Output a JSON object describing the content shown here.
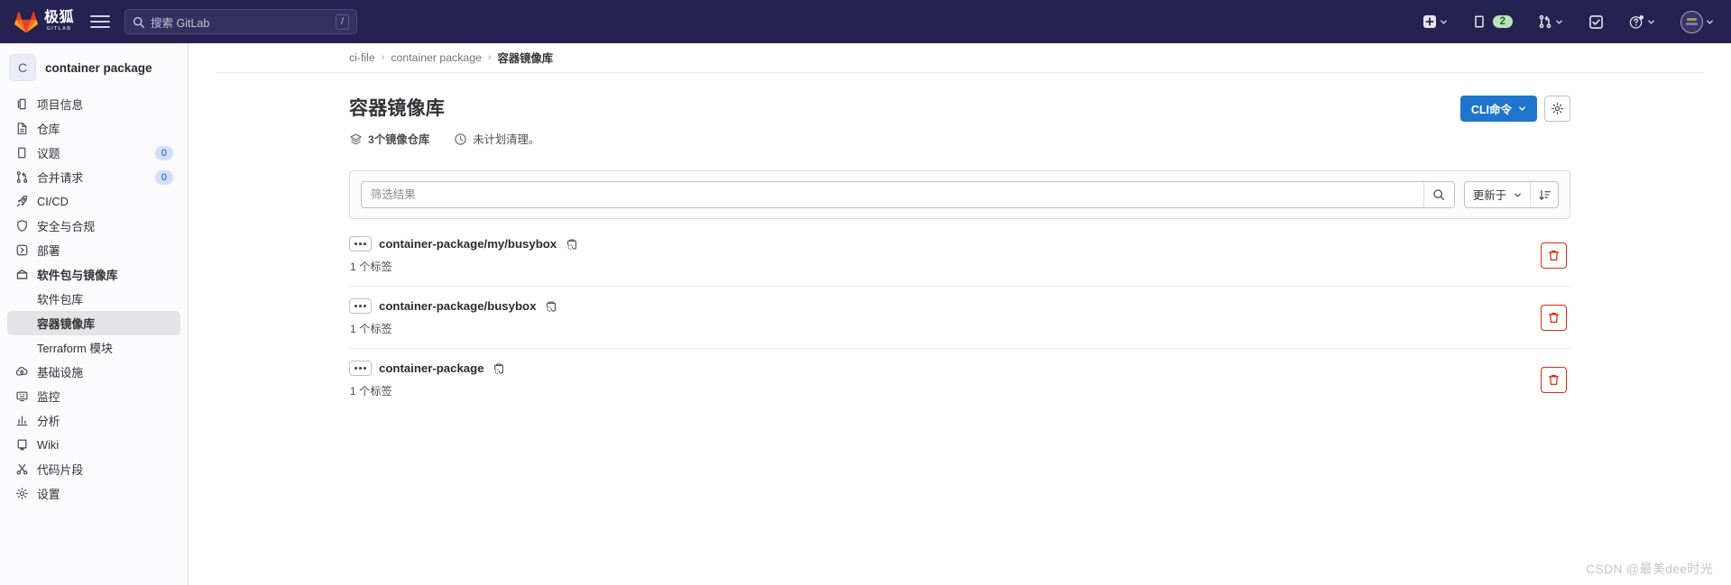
{
  "topbar": {
    "brand_cn": "极狐",
    "brand_sub": "GITLAB",
    "menu_label": "主菜单",
    "search": {
      "placeholder": "搜索 GitLab",
      "shortcut": "/"
    },
    "actions": {
      "create_label": "创建新的…",
      "issues_label": "议题",
      "issues_count": "2",
      "merge_requests_label": "合并请求",
      "todos_label": "待办事项",
      "help_label": "帮助",
      "user_label": "用户菜单"
    }
  },
  "sidebar": {
    "project": {
      "initial": "C",
      "name": "container package"
    },
    "items": [
      {
        "label": "项目信息",
        "icon": "project-information-icon",
        "badge": ""
      },
      {
        "label": "仓库",
        "icon": "repository-icon",
        "badge": ""
      },
      {
        "label": "议题",
        "icon": "issues-icon",
        "badge": "0"
      },
      {
        "label": "合并请求",
        "icon": "merge-request-icon",
        "badge": "0"
      },
      {
        "label": "CI/CD",
        "icon": "rocket-icon",
        "badge": ""
      },
      {
        "label": "安全与合规",
        "icon": "shield-icon",
        "badge": ""
      },
      {
        "label": "部署",
        "icon": "deployments-icon",
        "badge": ""
      },
      {
        "label": "软件包与镜像库",
        "icon": "package-icon",
        "badge": ""
      }
    ],
    "subitems": [
      {
        "label": "软件包库",
        "active": false
      },
      {
        "label": "容器镜像库",
        "active": true
      },
      {
        "label": "Terraform 模块",
        "active": false
      }
    ],
    "items_after": [
      {
        "label": "基础设施",
        "icon": "infrastructure-icon",
        "badge": ""
      },
      {
        "label": "监控",
        "icon": "monitor-icon",
        "badge": ""
      },
      {
        "label": "分析",
        "icon": "analytics-icon",
        "badge": ""
      },
      {
        "label": "Wiki",
        "icon": "wiki-icon",
        "badge": ""
      },
      {
        "label": "代码片段",
        "icon": "snippet-icon",
        "badge": ""
      },
      {
        "label": "设置",
        "icon": "gear-icon",
        "badge": ""
      }
    ]
  },
  "breadcrumb": [
    {
      "label": "ci-file",
      "current": false
    },
    {
      "label": "container package",
      "current": false
    },
    {
      "label": "容器镜像库",
      "current": true
    }
  ],
  "page": {
    "title": "容器镜像库",
    "meta_repos": "3个镜像仓库",
    "meta_cleanup": "未计划清理。",
    "cli_button": "CLI命令",
    "settings_button_label": "设置"
  },
  "filter": {
    "placeholder": "筛选结果",
    "value": "",
    "search_button_label": "搜索",
    "sort_label": "更新于",
    "sort_direction_label": "降序排列"
  },
  "repositories": [
    {
      "name": "container-package/my/busybox",
      "tags": "1 个标签",
      "copy_label": "复制镜像路径",
      "delete_label": "删除镜像仓库"
    },
    {
      "name": "container-package/busybox",
      "tags": "1 个标签",
      "copy_label": "复制镜像路径",
      "delete_label": "删除镜像仓库"
    },
    {
      "name": "container-package",
      "tags": "1 个标签",
      "copy_label": "复制镜像路径",
      "delete_label": "删除镜像仓库"
    }
  ],
  "watermark": "CSDN @最美dee时光",
  "colors": {
    "topbar_bg": "#252150",
    "accent_blue": "#1f75cb",
    "danger_red": "#dd2b0e",
    "badge_green": "#b7e5b7"
  }
}
